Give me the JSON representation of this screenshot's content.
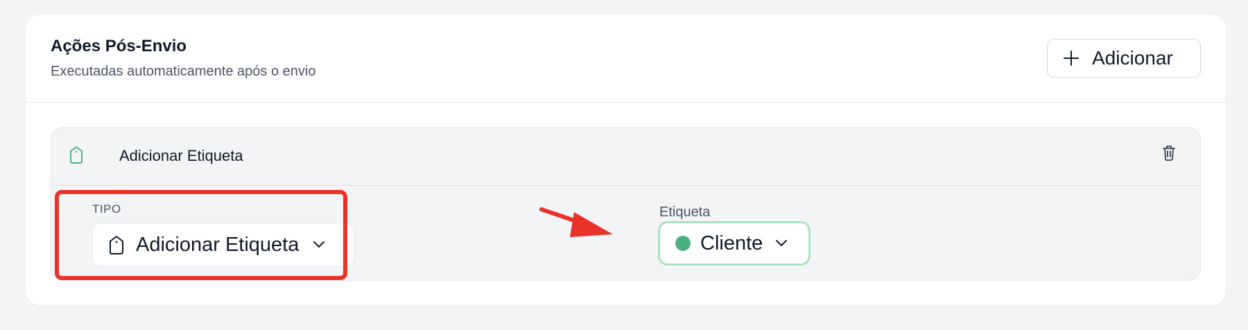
{
  "section": {
    "title": "Ações Pós-Envio",
    "subtitle": "Executadas automaticamente após o envio",
    "add_button_label": "Adicionar"
  },
  "action": {
    "title": "Adicionar Etiqueta",
    "tipo_label": "TIPO",
    "tipo_value": "Adicionar Etiqueta",
    "etiqueta_label": "Etiqueta",
    "etiqueta_value": "Cliente"
  },
  "icons": {
    "add": "plus-icon",
    "tag": "tag-icon",
    "delete": "trash-icon",
    "dropdown": "chevron-down-icon"
  },
  "colors": {
    "tag_green": "#4caf82",
    "highlight_red": "#e8322a",
    "focus_green": "#a7e3bf"
  }
}
